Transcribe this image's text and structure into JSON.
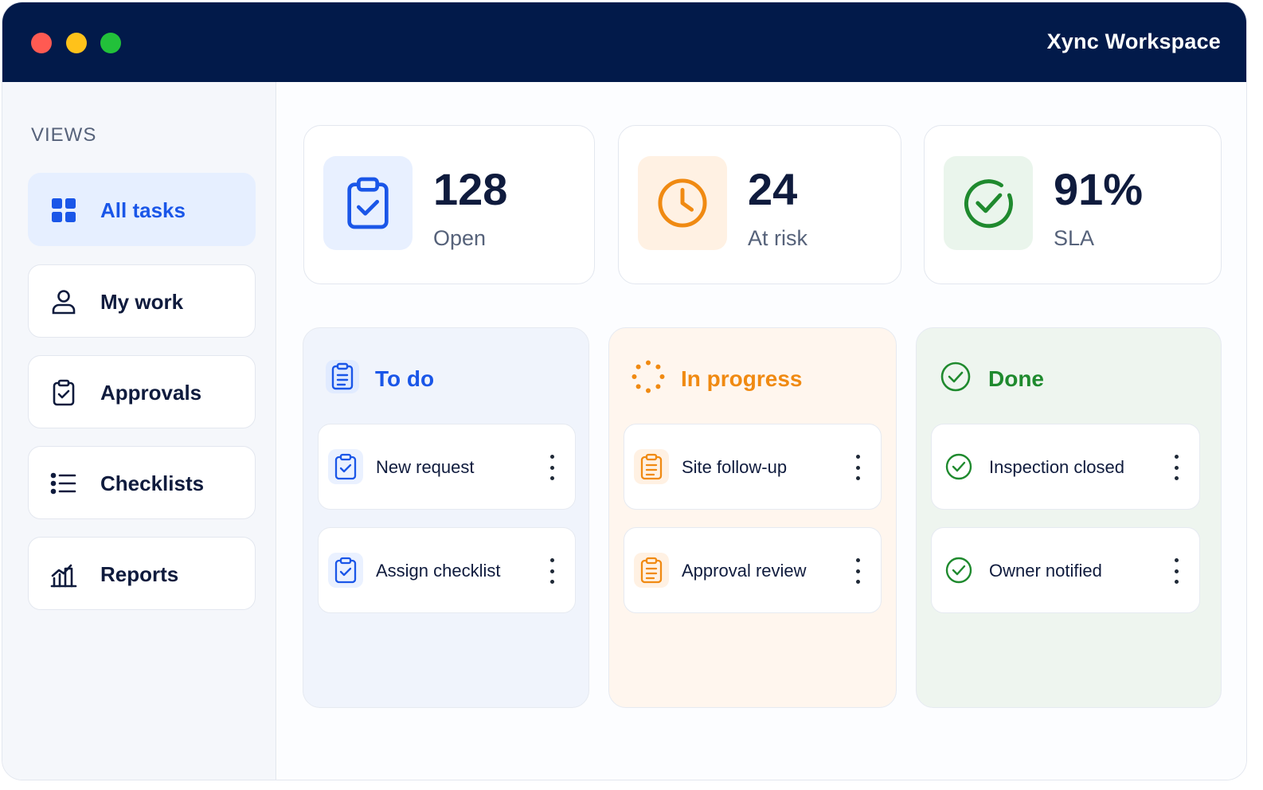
{
  "window": {
    "app_title": "Xync Workspace"
  },
  "sidebar": {
    "section_label": "VIEWS",
    "items": [
      {
        "label": "All tasks",
        "icon": "grid-icon",
        "active": true
      },
      {
        "label": "My work",
        "icon": "user-icon"
      },
      {
        "label": "Approvals",
        "icon": "clipboard-check-icon"
      },
      {
        "label": "Checklists",
        "icon": "list-icon"
      },
      {
        "label": "Reports",
        "icon": "chart-icon"
      }
    ]
  },
  "stats": [
    {
      "value": "128",
      "label": "Open",
      "icon": "clipboard-check-icon",
      "color": "#1a56e8"
    },
    {
      "value": "24",
      "label": "At risk",
      "icon": "clock-icon",
      "color": "#f08a12"
    },
    {
      "value": "91%",
      "label": "SLA",
      "icon": "check-circle-icon",
      "color": "#1f8a2e"
    }
  ],
  "columns": [
    {
      "title": "To do",
      "icon": "clipboard-list-icon",
      "color": "#1a56e8",
      "cards": [
        {
          "label": "New request",
          "icon": "clipboard-check-icon"
        },
        {
          "label": "Assign checklist",
          "icon": "clipboard-check-icon"
        }
      ]
    },
    {
      "title": "In progress",
      "icon": "loading-icon",
      "color": "#f08a12",
      "cards": [
        {
          "label": "Site follow-up",
          "icon": "clipboard-list-icon"
        },
        {
          "label": "Approval review",
          "icon": "clipboard-list-icon"
        }
      ]
    },
    {
      "title": "Done",
      "icon": "check-circle-icon",
      "color": "#1f8a2e",
      "cards": [
        {
          "label": "Inspection closed",
          "icon": "check-circle-icon"
        },
        {
          "label": "Owner notified",
          "icon": "check-circle-icon"
        }
      ]
    }
  ]
}
